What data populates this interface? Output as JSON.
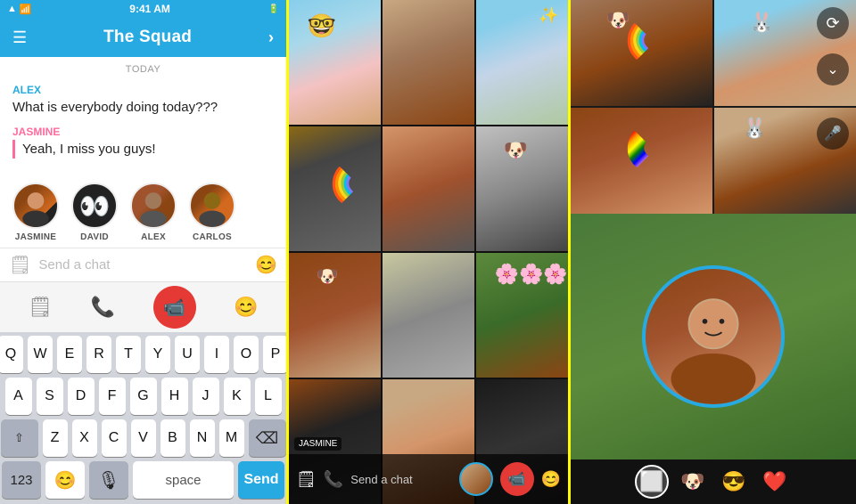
{
  "app": {
    "title": "The Squad",
    "statusBar": {
      "time": "9:41 AM",
      "wifi": "WiFi",
      "battery": "100%"
    }
  },
  "chat": {
    "date": "TODAY",
    "messages": [
      {
        "sender": "ALEX",
        "senderColor": "#27AAE1",
        "text": "What is everybody doing today???"
      },
      {
        "sender": "JASMINE",
        "senderColor": "#FF6B9D",
        "text": "Yeah, I miss you guys!"
      }
    ],
    "avatars": [
      {
        "name": "JASMINE",
        "emoji": "👩"
      },
      {
        "name": "DAVID",
        "emoji": "👀"
      },
      {
        "name": "ALEX",
        "emoji": "👦"
      },
      {
        "name": "CARLOS",
        "emoji": "👦🏽"
      }
    ],
    "inputPlaceholder": "Send a chat",
    "sendLabel": "Send",
    "spaceLabel": "space",
    "numLabel": "123"
  },
  "keyboard": {
    "row1": [
      "Q",
      "W",
      "E",
      "R",
      "T",
      "Y",
      "U",
      "I",
      "O",
      "P"
    ],
    "row2": [
      "A",
      "S",
      "D",
      "F",
      "G",
      "H",
      "J",
      "K",
      "L"
    ],
    "row3": [
      "Z",
      "X",
      "C",
      "V",
      "B",
      "N",
      "M"
    ],
    "micIcon": "🎙",
    "emojiIcon": "😊",
    "deleteIcon": "⌫",
    "shiftIcon": "⇧"
  },
  "middlePanel": {
    "chatPlaceholder": "Send a chat",
    "jasmineName": "JASMINE"
  },
  "rightPanel": {
    "emojis": [
      "⬜",
      "🐶",
      "😎",
      "❤️"
    ],
    "micIcon": "🎤",
    "switchIcon": "🔄"
  },
  "colors": {
    "snapBlue": "#27AAE1",
    "snapYellow": "#FFFC00",
    "red": "#E53935",
    "jasminePink": "#FF6B9D"
  }
}
